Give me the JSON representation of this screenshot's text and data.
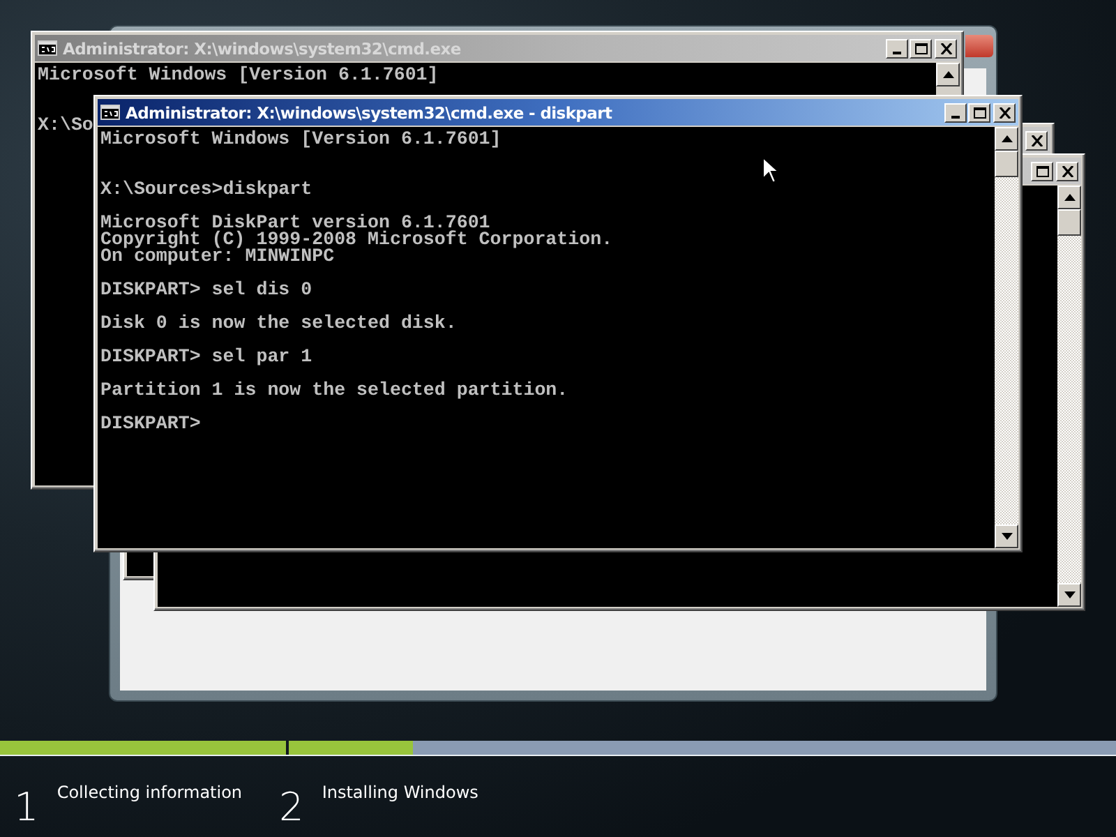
{
  "consoles": [
    {
      "title": "Administrator: X:\\windows\\system32\\cmd.exe",
      "active": false,
      "blocks": [
        [
          "Microsoft Windows [Version 6.1.7601]"
        ],
        [
          "X:\\So"
        ]
      ]
    },
    {
      "title": "Administrator: X:\\windows\\system32\\cmd.exe - diskpart",
      "active": true,
      "blocks": [
        [
          "Microsoft Windows [Version 6.1.7601]"
        ],
        [
          "X:\\Sources>diskpart"
        ],
        [
          "Microsoft DiskPart version 6.1.7601",
          "Copyright (C) 1999-2008 Microsoft Corporation.",
          "On computer: MINWINPC"
        ],
        [
          "DISKPART> sel dis 0"
        ],
        [
          "Disk 0 is now the selected disk."
        ],
        [
          "DISKPART> sel par 1"
        ],
        [
          "Partition 1 is now the selected partition."
        ],
        [
          "DISKPART>"
        ]
      ]
    }
  ],
  "steps": [
    {
      "number": "1",
      "label": "Collecting information",
      "level": 1
    },
    {
      "number": "2",
      "label": "Installing Windows",
      "level": 0.15
    }
  ]
}
